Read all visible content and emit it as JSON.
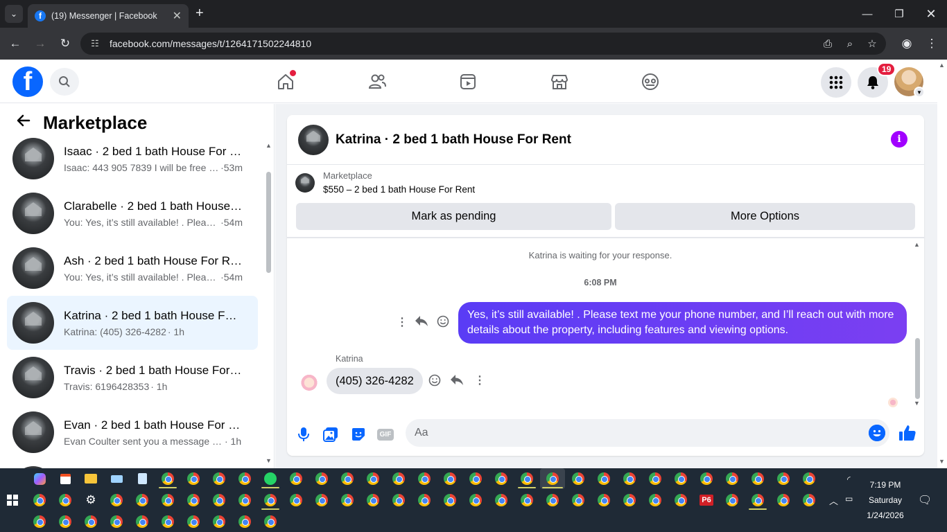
{
  "browser": {
    "tab_title": "(19) Messenger | Facebook",
    "url": "facebook.com/messages/t/1264171502244810"
  },
  "header": {
    "notification_count": "19"
  },
  "sidebar": {
    "title": "Marketplace",
    "conversations": [
      {
        "name": "Isaac · 2 bed 1 bath House For R...",
        "preview": "Isaac: 443 905 7839 I will be free i...",
        "time": "·53m",
        "active": false
      },
      {
        "name": "Clarabelle · 2 bed 1 bath House F...",
        "preview": "You: Yes, it’s still available! . Please...",
        "time": "·54m",
        "active": false
      },
      {
        "name": "Ash · 2 bed 1 bath House For Rent",
        "preview": "You: Yes, it’s still available! . Please...",
        "time": "·54m",
        "active": false
      },
      {
        "name": "Katrina · 2 bed 1 bath House For ...",
        "preview": "Katrina: (405) 326-4282",
        "time": "· 1h",
        "active": true
      },
      {
        "name": "Travis · 2 bed 1 bath House For R...",
        "preview": "Travis: 6196428353",
        "time": "· 1h",
        "active": false
      },
      {
        "name": "Evan · 2 bed 1 bath House For Re...",
        "preview": "Evan Coulter sent you a message a...",
        "time": "· 1h",
        "active": false
      }
    ]
  },
  "chat": {
    "title": "Katrina · 2 bed 1 bath House For Rent",
    "marketplace_label": "Marketplace",
    "listing": "$550 – 2 bed 1 bath House For Rent",
    "mark_pending_label": "Mark as pending",
    "more_options_label": "More Options",
    "waiting_text": "Katrina is waiting for your response.",
    "timestamp": "6:08 PM",
    "outgoing_message": "Yes, it’s still available! . Please text me your phone number, and I’ll reach out with more details about the property, including features and viewing options.",
    "sender_name": "Katrina",
    "incoming_message": "(405) 326-4282",
    "composer_placeholder": "Aa",
    "gif_label": "GIF"
  },
  "taskbar": {
    "time": "7:19 PM",
    "day": "Saturday",
    "date": "1/24/2026",
    "p6_label": "P6"
  },
  "colors": {
    "messenger_blue": "#0866ff",
    "bubble_purple": "#6a3df3",
    "info_purple": "#a100ff",
    "badge_red": "#e41e3f"
  }
}
